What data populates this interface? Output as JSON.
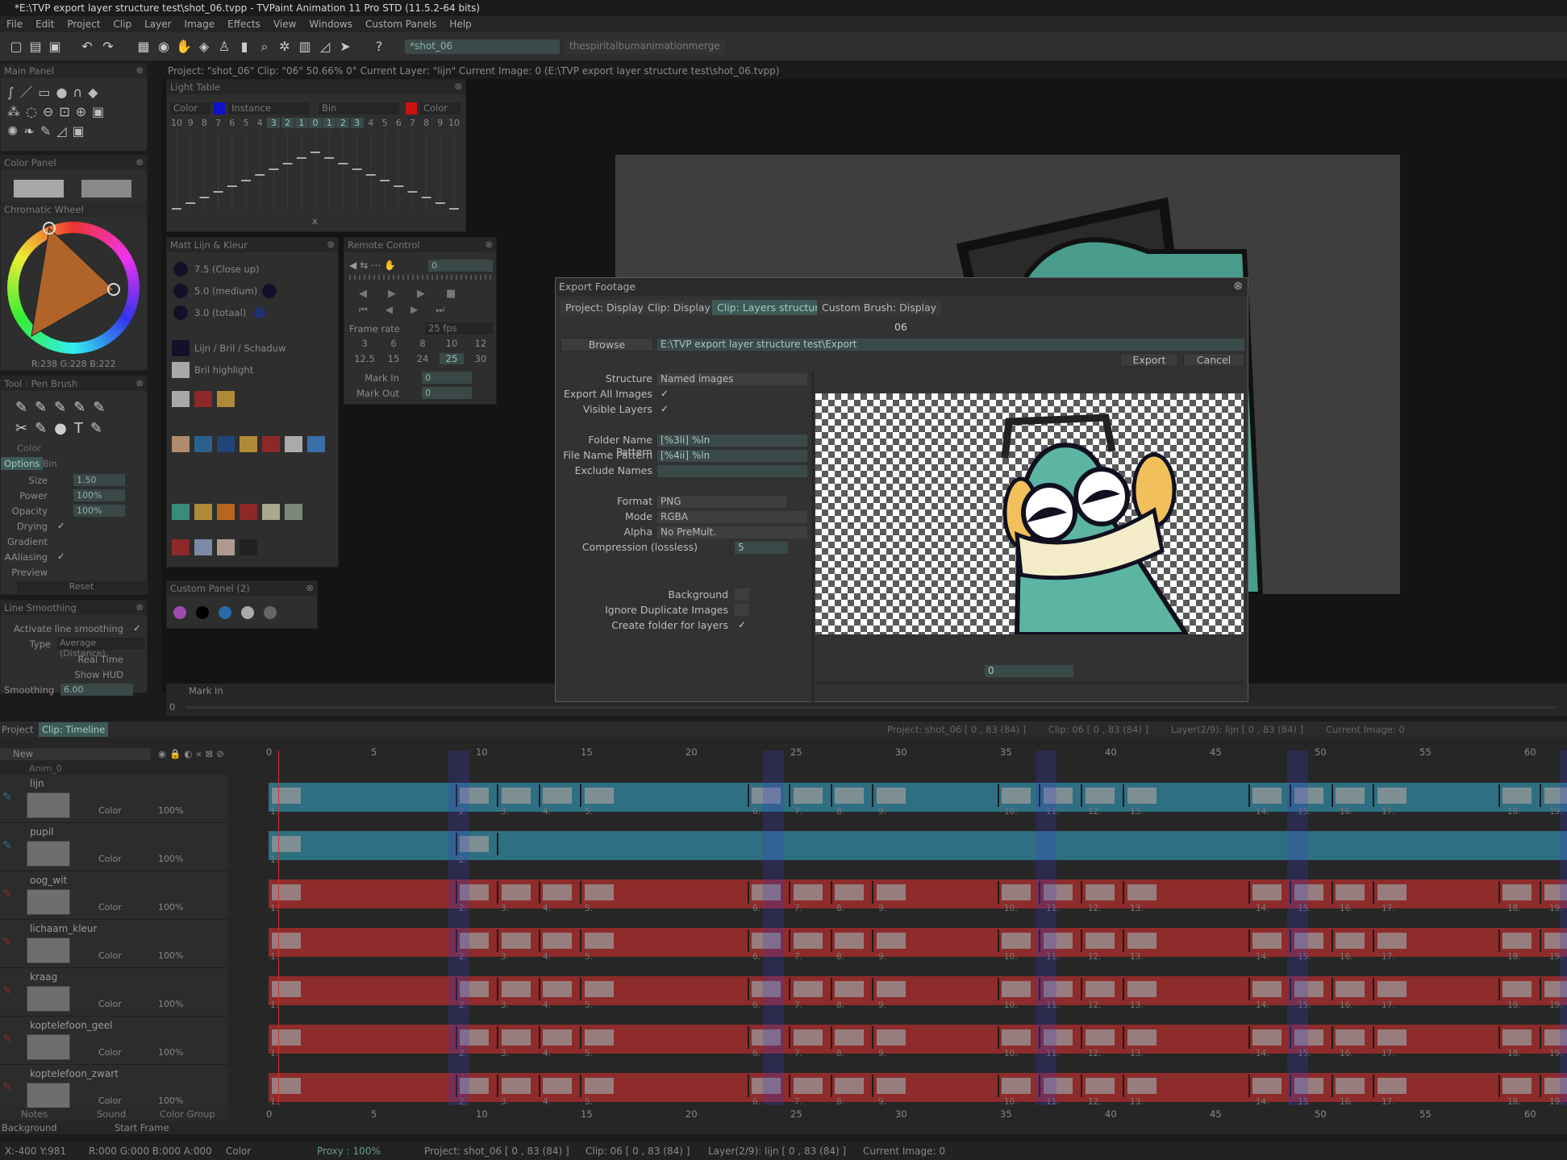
{
  "window": {
    "title": "*E:\\TVP export layer structure test\\shot_06.tvpp - TVPaint Animation 11 Pro STD (11.5.2-64 bits)"
  },
  "menu": [
    "File",
    "Edit",
    "Project",
    "Clip",
    "Layer",
    "Image",
    "Effects",
    "View",
    "Windows",
    "Custom Panels",
    "Help"
  ],
  "toolbar": {
    "tab1": "*shot_06",
    "tab2": "thespiritalbumanimationmerge"
  },
  "infobar": "Project: \"shot_06\"  Clip: \"06\"  50.66%  0°  Current Layer: \"lijn\"  Current Image: 0 (E:\\TVP export layer structure test\\shot_06.tvpp)",
  "main_panel": {
    "title": "Main Panel"
  },
  "color_panel": {
    "title": "Color Panel",
    "wheel_title": "Chromatic Wheel",
    "rgb": "R:238 G:228 B:222"
  },
  "tool_panel": {
    "title": "Tool : Pen Brush",
    "color": "Color",
    "tab_options": "Options",
    "tab_bin": "Bin",
    "size_label": "Size",
    "size": "1.50",
    "power_label": "Power",
    "power": "100%",
    "opacity_label": "Opacity",
    "opacity": "100%",
    "drying": "Drying",
    "gradient": "Gradient",
    "aaliasing": "AAliasing",
    "preview": "Preview",
    "reset": "Reset"
  },
  "line_smoothing": {
    "title": "Line Smoothing",
    "activate": "Activate line smoothing",
    "type_label": "Type",
    "type": "Average (Distance)",
    "realtime": "Real Time",
    "showhud": "Show HUD",
    "smoothing_label": "Smoothing",
    "smoothing": "6.00"
  },
  "light_table": {
    "title": "Light Table",
    "color1": "Color",
    "instance": "Instance",
    "bin": "Bin",
    "color2": "Color",
    "numbers": [
      "10",
      "9",
      "8",
      "7",
      "6",
      "5",
      "4",
      "3",
      "2",
      "1",
      "0",
      "1",
      "2",
      "3",
      "4",
      "5",
      "6",
      "7",
      "8",
      "9",
      "10"
    ],
    "x": "x"
  },
  "matt": {
    "title": "Matt Lijn & Kleur",
    "s1": "7.5 (Close up)",
    "s2": "5.0 (medium)",
    "s3": "3.0 (totaal)",
    "c1": "Lijn / Bril / Schaduw",
    "c2": "Bril highlight",
    "colors": {
      "dark": "#15102a",
      "red": "#8e2727",
      "gold": "#b08a38",
      "teal": "#3a8c7a",
      "blue": "#2b5f8f"
    }
  },
  "remote": {
    "title": "Remote Control",
    "frame": "0",
    "fps_label": "Frame rate",
    "fps": "25 fps",
    "fps_values": [
      "3",
      "6",
      "8",
      "10",
      "12",
      "12.5",
      "15",
      "24",
      "25",
      "30"
    ],
    "markin_label": "Mark In",
    "markin": "0",
    "markout_label": "Mark Out",
    "markout": "0"
  },
  "custom_panel": {
    "title": "Custom Panel (2)"
  },
  "canvas_bottom": {
    "markin": "Mark In",
    "frame": "0"
  },
  "dialog": {
    "title": "Export Footage",
    "tabs": [
      "Project: Display",
      "Clip: Display",
      "Clip: Layers structure",
      "Custom Brush: Display"
    ],
    "clip_name": "06",
    "browse": "Browse",
    "path": "E:\\TVP export layer structure test\\Export",
    "export": "Export",
    "cancel": "Cancel",
    "structure_label": "Structure",
    "structure": "Named images",
    "export_all": "Export All Images",
    "visible_layers": "Visible Layers",
    "folder_pattern_label": "Folder Name Pattern",
    "folder_pattern": "[%3li] %ln",
    "file_pattern_label": "File Name Pattern",
    "file_pattern": "[%4ii] %ln",
    "exclude_label": "Exclude Names",
    "format_label": "Format",
    "format": "PNG",
    "mode_label": "Mode",
    "mode": "RGBA",
    "alpha_label": "Alpha",
    "alpha": "No PreMult.",
    "compression_label": "Compression (lossless)",
    "compression": "5",
    "background": "Background",
    "ignore_dup": "Ignore Duplicate Images",
    "create_folder": "Create folder for layers",
    "preview_frame": "0"
  },
  "timeline": {
    "tab_project": "Project",
    "tab_clip": "Clip: Timeline",
    "new": "New",
    "info": [
      "Project: shot_06 [ 0 , 83  (84) ]",
      "Clip: 06 [ 0 , 83  (84) ]",
      "Layer(2/9): lijn [ 0 , 83  (84) ]",
      "Current Image: 0"
    ],
    "ruler": [
      "0",
      "5",
      "10",
      "15",
      "20",
      "25",
      "30",
      "35",
      "40",
      "45",
      "50",
      "55",
      "60"
    ],
    "anim": "Anim_0",
    "layers": [
      {
        "name": "lijn",
        "mode": "Color",
        "opacity": "100%",
        "color": "#2f6f83"
      },
      {
        "name": "pupil",
        "mode": "Color",
        "opacity": "100%",
        "color": "#2f6f83"
      },
      {
        "name": "oog_wit",
        "mode": "Color",
        "opacity": "100%",
        "color": "#8e2b2b"
      },
      {
        "name": "lichaam_kleur",
        "mode": "Color",
        "opacity": "100%",
        "color": "#8e2b2b"
      },
      {
        "name": "kraag",
        "mode": "Color",
        "opacity": "100%",
        "color": "#8e2b2b"
      },
      {
        "name": "koptelefoon_geel",
        "mode": "Color",
        "opacity": "100%",
        "color": "#8e2b2b"
      },
      {
        "name": "koptelefoon_zwart",
        "mode": "Color",
        "opacity": "100%",
        "color": "#8e2b2b"
      }
    ],
    "cell_numbers": [
      "1.",
      "2.",
      "3.",
      "4.",
      "5.",
      "6.",
      "7.",
      "8.",
      "9.",
      "10.",
      "11.",
      "12.",
      "13.",
      "14.",
      "15.",
      "16.",
      "17.",
      "18.",
      "19."
    ],
    "bottom": {
      "notes": "Notes",
      "sound": "Sound",
      "color_group": "Color Group",
      "background": "Background",
      "start_frame": "Start Frame"
    }
  },
  "status": {
    "xy": "X:-400  Y:981",
    "rgba": "R:000 G:000 B:000 A:000",
    "color": "Color",
    "proxy": "Proxy : 100%",
    "project": "Project: shot_06 [ 0 , 83  (84) ]",
    "clip": "Clip: 06 [ 0 , 83  (84) ]",
    "layer": "Layer(2/9): lijn [ 0 , 83  (84) ]",
    "image": "Current Image: 0"
  }
}
